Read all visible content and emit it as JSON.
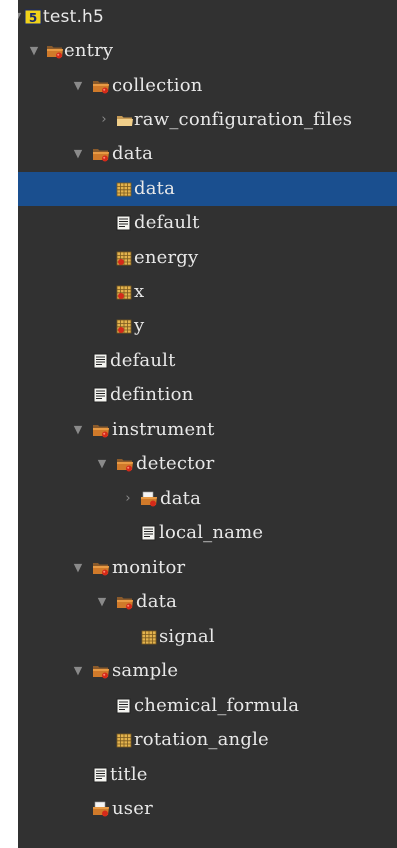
{
  "colors": {
    "panel_background": "#313131",
    "selection": "#1a4f8f",
    "text": "#e8e8e8",
    "arrow": "#8a8a8a"
  },
  "tree": {
    "root": {
      "label": "test.h5",
      "icon": "hdf5-file-icon",
      "expanded": true
    },
    "entry": {
      "label": "entry",
      "icon": "group-folder-icon",
      "expanded": true
    },
    "collection": {
      "label": "collection",
      "icon": "group-folder-icon",
      "expanded": true
    },
    "raw_configuration": {
      "label": "raw_configuration_files",
      "icon": "folder-icon",
      "expanded": false
    },
    "data_group": {
      "label": "data",
      "icon": "group-folder-icon",
      "expanded": true
    },
    "data_dataset": {
      "label": "data",
      "icon": "dataset-grid-icon",
      "selected": true
    },
    "default_inner": {
      "label": "default",
      "icon": "text-dataset-icon"
    },
    "energy": {
      "label": "energy",
      "icon": "link-dataset-icon"
    },
    "x": {
      "label": "x",
      "icon": "link-dataset-icon"
    },
    "y": {
      "label": "y",
      "icon": "link-dataset-icon"
    },
    "default_outer": {
      "label": "default",
      "icon": "text-dataset-icon"
    },
    "defintion": {
      "label": "defintion",
      "icon": "text-dataset-icon"
    },
    "instrument": {
      "label": "instrument",
      "icon": "group-folder-icon",
      "expanded": true
    },
    "detector": {
      "label": "detector",
      "icon": "group-folder-icon",
      "expanded": true
    },
    "detector_data": {
      "label": "data",
      "icon": "link-folder-icon",
      "expanded": false
    },
    "local_name": {
      "label": "local_name",
      "icon": "text-dataset-icon"
    },
    "monitor": {
      "label": "monitor",
      "icon": "group-folder-icon",
      "expanded": true
    },
    "monitor_data": {
      "label": "data",
      "icon": "group-folder-icon",
      "expanded": true
    },
    "signal": {
      "label": "signal",
      "icon": "dataset-grid-icon"
    },
    "sample": {
      "label": "sample",
      "icon": "group-folder-icon",
      "expanded": true
    },
    "chemical_formula": {
      "label": "chemical_formula",
      "icon": "text-dataset-icon"
    },
    "rotation_angle": {
      "label": "rotation_angle",
      "icon": "dataset-grid-icon"
    },
    "title": {
      "label": "title",
      "icon": "text-dataset-icon"
    },
    "user": {
      "label": "user",
      "icon": "link-folder-icon"
    }
  }
}
